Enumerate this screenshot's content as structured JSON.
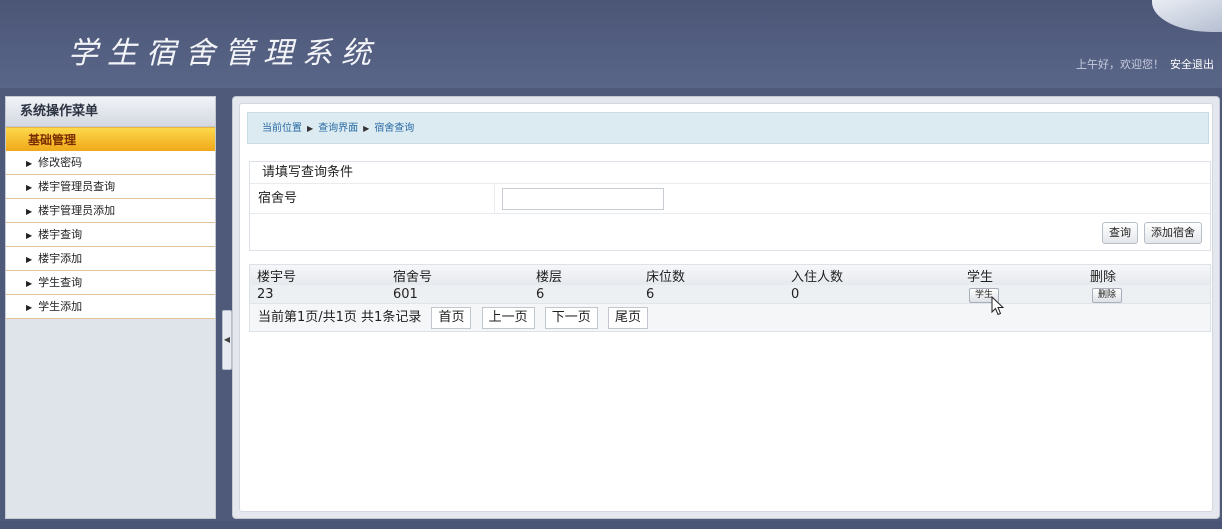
{
  "header": {
    "logo": "学生宿舍管理系统",
    "greeting": "上午好，欢迎您！",
    "logout": "安全退出"
  },
  "sidebar": {
    "title": "系统操作菜单",
    "group": "基础管理",
    "items": [
      {
        "label": "修改密码"
      },
      {
        "label": "楼宇管理员查询"
      },
      {
        "label": "楼宇管理员添加"
      },
      {
        "label": "楼宇查询"
      },
      {
        "label": "楼宇添加"
      },
      {
        "label": "学生查询"
      },
      {
        "label": "学生添加"
      }
    ]
  },
  "breadcrumb": [
    "当前位置",
    "查询界面",
    "宿舍查询"
  ],
  "query": {
    "title": "请填写查询条件",
    "field_label": "宿舍号",
    "field_value": "",
    "search_button": "查询",
    "add_button": "添加宿舍"
  },
  "table": {
    "columns": [
      "楼宇号",
      "宿舍号",
      "楼层",
      "床位数",
      "入住人数",
      "学生",
      "删除"
    ],
    "rows": [
      {
        "building": "23",
        "room": "601",
        "floor": "6",
        "beds": "6",
        "occupants": "0",
        "student_btn": "学生",
        "delete_btn": "删除"
      }
    ]
  },
  "pager": {
    "status": "当前第1页/共1页 共1条记录",
    "first": "首页",
    "prev": "上一页",
    "next": "下一页",
    "last": "尾页"
  }
}
